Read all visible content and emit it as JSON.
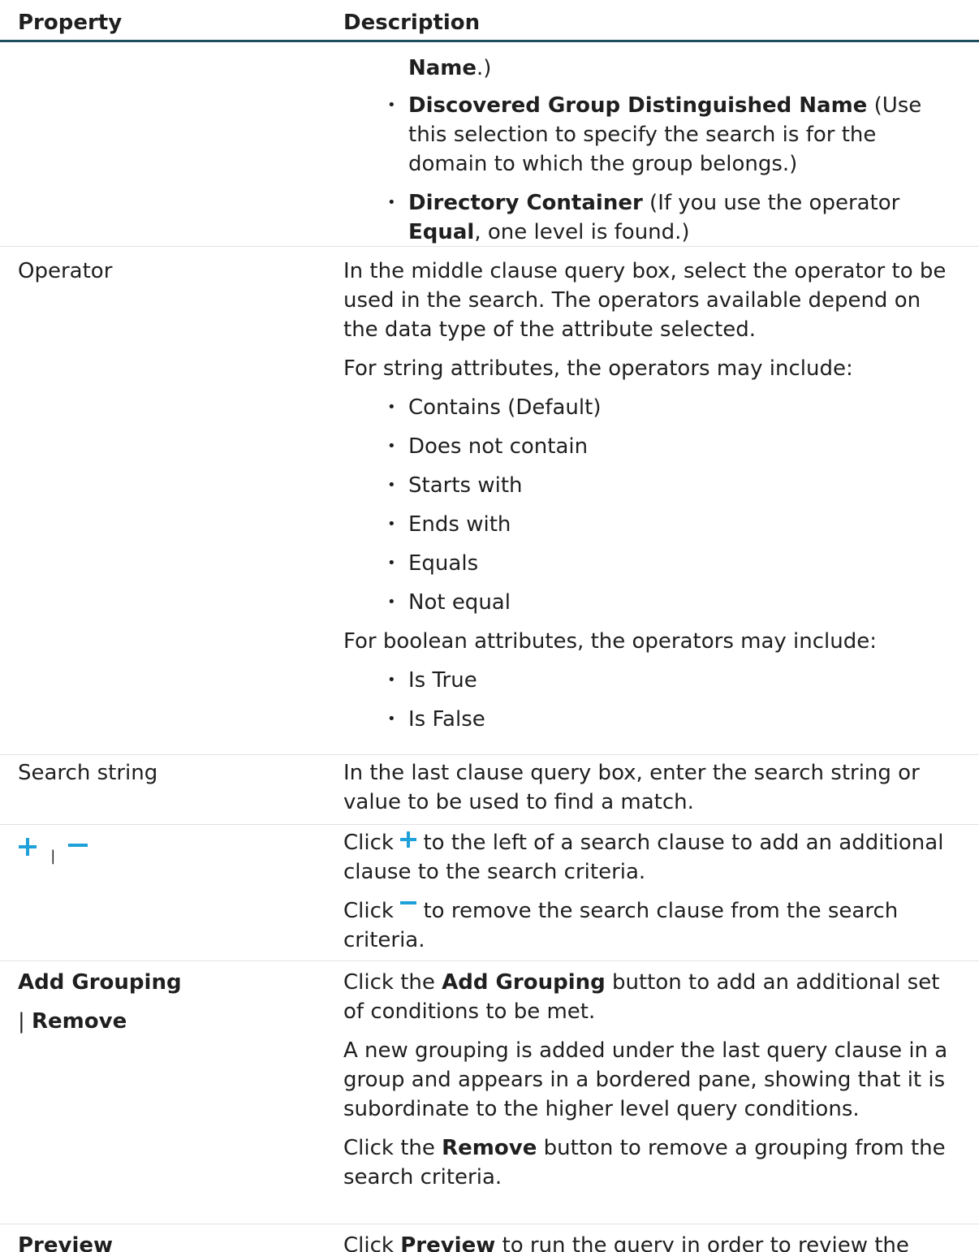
{
  "header": {
    "property": "Property",
    "description": "Description"
  },
  "continuation": {
    "lead_bold": "Name",
    "lead_rest": ".)",
    "items": [
      {
        "bold": "Discovered Group Distinguished Name",
        "rest": " (Use this selection to specify the search is for the domain to which the group belongs.)"
      },
      {
        "bold": "Directory Container",
        "rest": " (If you use the operator ",
        "bold2": "Equal",
        "rest2": ", one level is found.)"
      }
    ]
  },
  "operator": {
    "property": "Operator",
    "intro": "In the middle clause query box, select the operator to be used in the search. The operators available depend on the data type of the attribute selected.",
    "string_intro": "For string attributes, the operators may include:",
    "string_ops": [
      "Contains (Default)",
      "Does not contain",
      "Starts with",
      "Ends with",
      "Equals",
      "Not equal"
    ],
    "boolean_intro": "For boolean attributes, the operators may include:",
    "boolean_ops": [
      "Is True",
      "Is False"
    ]
  },
  "search_string": {
    "property": "Search string",
    "description": "In the last clause query box, enter the search string or value to be used to find a match."
  },
  "plus_minus": {
    "separator": "|",
    "add_pre": "Click ",
    "add_post": " to the left of a search clause to add an additional clause to the search criteria.",
    "remove_pre": "Click ",
    "remove_post": " to remove the search clause from the search criteria.",
    "icon_color": "#1ea0d9",
    "add_icon": "plus-icon",
    "remove_icon": "minus-icon"
  },
  "add_grouping": {
    "property_line1": "Add Grouping",
    "property_sep": "| ",
    "property_line2": "Remove",
    "p1_pre": "Click the ",
    "p1_bold": "Add Grouping",
    "p1_post": " button to add an additional set of conditions to be met.",
    "p2": "A new grouping is added under the last query clause in a group and appears in a bordered pane, showing that it is subordinate to the higher level query conditions.",
    "p3_pre": "Click the ",
    "p3_bold": "Remove",
    "p3_post": " button to remove a grouping from the search criteria."
  },
  "preview": {
    "property": "Preview",
    "p_pre": "Click ",
    "p_bold": "Preview",
    "p_post": " to run the query in order to review the results of the query before adding the dynamic group."
  }
}
